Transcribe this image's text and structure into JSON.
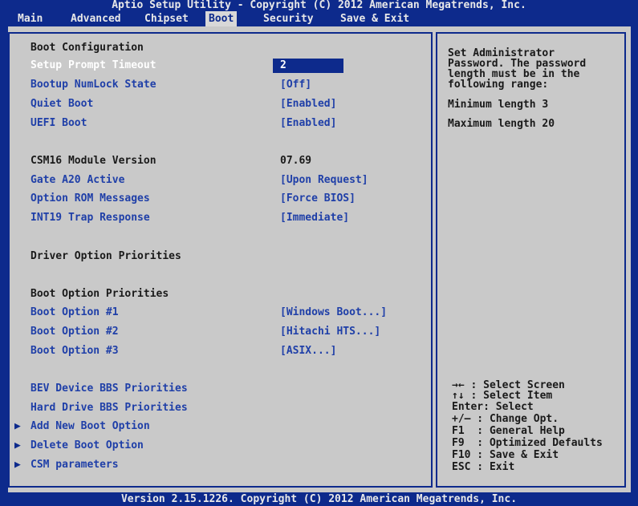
{
  "title": "Aptio Setup Utility - Copyright (C) 2012 American Megatrends, Inc.",
  "menu": [
    "Main",
    "Advanced",
    "Chipset",
    "Boot",
    "Security",
    "Save & Exit"
  ],
  "active_menu": "Boot",
  "sections": {
    "boot_configuration": "Boot Configuration",
    "setup_prompt_timeout": {
      "label": "Setup Prompt Timeout",
      "value": "2"
    },
    "bootup_numlock": {
      "label": "Bootup NumLock State",
      "value": "[Off]"
    },
    "quiet_boot": {
      "label": "Quiet Boot",
      "value": "[Enabled]"
    },
    "uefi_boot": {
      "label": "UEFI Boot",
      "value": "[Enabled]"
    },
    "csm16_version": {
      "label": "CSM16 Module Version",
      "value": "07.69"
    },
    "gate_a20": {
      "label": "Gate A20 Active",
      "value": "[Upon Request]"
    },
    "option_rom": {
      "label": "Option ROM Messages",
      "value": "[Force BIOS]"
    },
    "int19_trap": {
      "label": "INT19 Trap Response",
      "value": "[Immediate]"
    },
    "driver_option_priorities": "Driver Option Priorities",
    "boot_option_priorities": "Boot Option Priorities",
    "boot_option_1": {
      "label": "Boot Option #1",
      "value": "[Windows Boot...]"
    },
    "boot_option_2": {
      "label": "Boot Option #2",
      "value": "[Hitachi HTS...]"
    },
    "boot_option_3": {
      "label": "Boot Option #3",
      "value": "[ASIX...]"
    },
    "bev_device_bbs": "BEV Device BBS Priorities",
    "hard_drive_bbs": "Hard Drive BBS Priorities",
    "add_new_boot_option": "Add New Boot Option",
    "delete_boot_option": "Delete Boot Option",
    "csm_parameters": "CSM parameters"
  },
  "help": {
    "line1": "Set Administrator",
    "line2": "Password. The password",
    "line3": "length must be in the",
    "line4": "following range:",
    "min": "Minimum length 3",
    "max": "Maximum length 20"
  },
  "keys": [
    "→← : Select Screen",
    "↑↓ : Select Item",
    "Enter: Select",
    "+/— : Change Opt.",
    "F1  : General Help",
    "F9  : Optimized Defaults",
    "F10 : Save & Exit",
    "ESC : Exit"
  ],
  "footer": "Version 2.15.1226. Copyright (C) 2012 American Megatrends, Inc."
}
